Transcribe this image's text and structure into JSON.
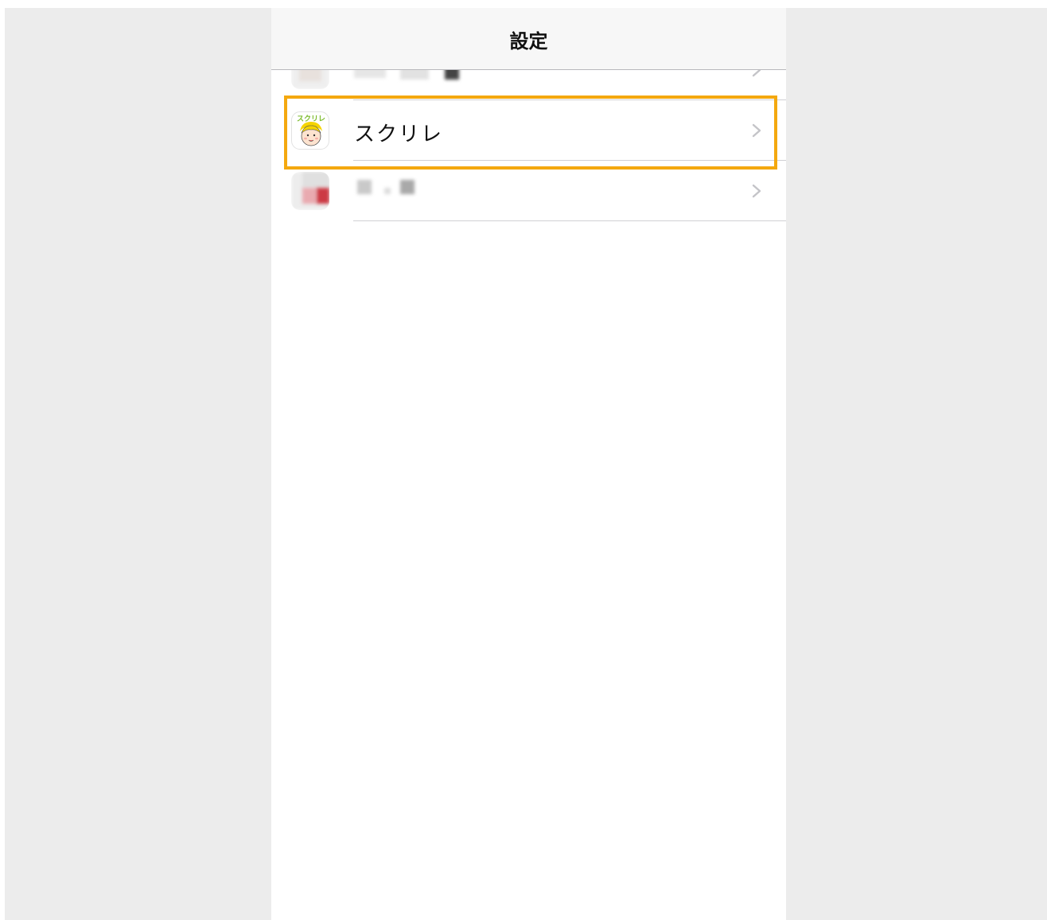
{
  "navbar": {
    "title": "設定"
  },
  "rows": [
    {
      "label": "",
      "obscured": true,
      "icon": "blurred-app-icon"
    },
    {
      "label": "スクリレ",
      "obscured": false,
      "icon": "sukurire-app-icon",
      "icon_text": "スクリレ",
      "highlighted": true
    },
    {
      "label": "",
      "obscured": true,
      "icon": "blurred-app-icon"
    }
  ],
  "colors": {
    "highlight": "#f4a80f",
    "backdrop": "#ececec",
    "navbar": "#f7f7f7"
  }
}
